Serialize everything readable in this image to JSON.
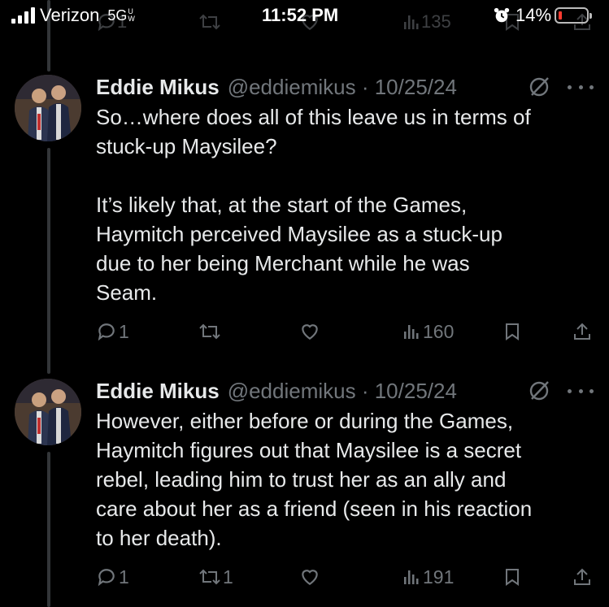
{
  "status_bar": {
    "carrier": "Verizon",
    "network": "5G",
    "network_suffix": "UW",
    "time": "11:52 PM",
    "battery": "14%",
    "battery_level": 0.14,
    "colors": {
      "battery_low": "#ff3b30"
    }
  },
  "previous_tweet_actions": {
    "replies": "1",
    "views": "135"
  },
  "tweets": [
    {
      "author_name": "Eddie Mikus",
      "handle_date": "@eddiemikus · 10/25/24",
      "text": "So…where does all of this leave us in terms of\nstuck-up Maysilee?\n\nIt’s likely that, at the start of the Games,\nHaymitch perceived Maysilee as a stuck-up\ndue to her being Merchant while he was\nSeam.",
      "replies": "1",
      "retweets": "",
      "likes": "",
      "views": "160"
    },
    {
      "author_name": "Eddie Mikus",
      "handle_date": "@eddiemikus · 10/25/24",
      "text": "However, either before or during the Games,\nHaymitch figures out that Maysilee is a secret\nrebel, leading him to trust her as an ally and\ncare about her as a friend (seen in his reaction\nto her death).",
      "replies": "1",
      "retweets": "1",
      "likes": "",
      "views": "191"
    }
  ],
  "icons": [
    "reply-icon",
    "retweet-icon",
    "like-icon",
    "views-icon",
    "bookmark-icon",
    "share-icon",
    "grok-icon",
    "more-icon",
    "alarm-icon",
    "signal-icon",
    "battery-icon"
  ],
  "colors": {
    "background": "#000000",
    "text": "#e7e9ea",
    "muted": "#71767b",
    "thread_line": "#333639"
  }
}
